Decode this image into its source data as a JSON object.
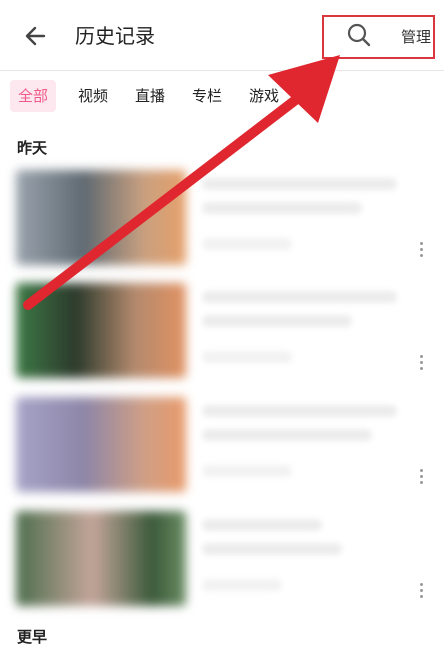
{
  "header": {
    "title": "历史记录",
    "manage_label": "管理"
  },
  "tabs": [
    {
      "label": "全部",
      "active": true
    },
    {
      "label": "视频",
      "active": false
    },
    {
      "label": "直播",
      "active": false
    },
    {
      "label": "专栏",
      "active": false
    },
    {
      "label": "游戏",
      "active": false
    }
  ],
  "sections": {
    "yesterday": "昨天",
    "earlier": "更早"
  },
  "colors": {
    "accent": "#f05a8a",
    "annotation_red": "#e0262e"
  },
  "icons": {
    "back": "arrow-left-icon",
    "search": "search-icon",
    "more": "more-vertical-icon"
  }
}
